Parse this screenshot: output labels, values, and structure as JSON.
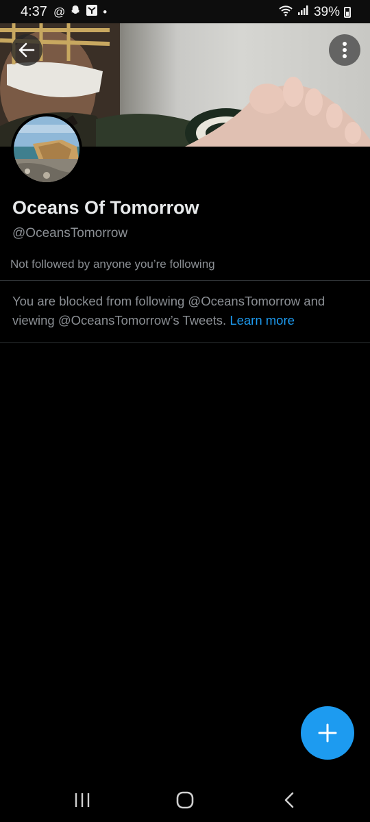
{
  "status_bar": {
    "time": "4:37",
    "left_icons": [
      "at-icon",
      "snapchat-icon",
      "app-icon",
      "dot-icon"
    ],
    "battery": "39%"
  },
  "profile": {
    "display_name": "Oceans Of Tomorrow",
    "handle": "@OceansTomorrow",
    "followers_note": "Not followed by anyone you’re following"
  },
  "blocked_notice": {
    "text": "You are blocked from following @OceansTomorrow and viewing @OceansTomorrow’s Tweets.",
    "link_label": "Learn more"
  },
  "colors": {
    "background": "#000000",
    "accent": "#1d9bf0",
    "secondary_text": "#8b8f94",
    "divider": "#2f3336"
  }
}
